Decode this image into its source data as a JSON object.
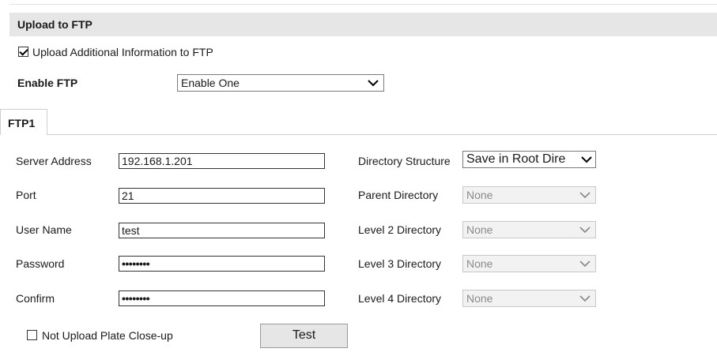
{
  "section": {
    "title": "Upload to FTP"
  },
  "upload_additional": {
    "label": "Upload Additional Information to FTP",
    "checked": true
  },
  "enable_ftp": {
    "label": "Enable FTP",
    "value": "Enable One"
  },
  "tab": {
    "label": "FTP1"
  },
  "fields": {
    "server_address": {
      "label": "Server Address",
      "value": "192.168.1.201"
    },
    "port": {
      "label": "Port",
      "value": "21"
    },
    "user_name": {
      "label": "User Name",
      "value": "test"
    },
    "password": {
      "label": "Password",
      "value": "••••••••"
    },
    "confirm": {
      "label": "Confirm",
      "value": "••••••••"
    }
  },
  "directories": {
    "structure": {
      "label": "Directory Structure",
      "value": "Save in Root Dire"
    },
    "parent": {
      "label": "Parent Directory",
      "value": "None"
    },
    "level2": {
      "label": "Level 2 Directory",
      "value": "None"
    },
    "level3": {
      "label": "Level 3 Directory",
      "value": "None"
    },
    "level4": {
      "label": "Level 4 Directory",
      "value": "None"
    }
  },
  "not_upload_plate": {
    "label": "Not Upload Plate Close-up",
    "checked": false
  },
  "test_button": {
    "label": "Test"
  },
  "colors": {
    "header_bg": "#e6e6e6",
    "disabled_text": "#8a8a8a"
  }
}
